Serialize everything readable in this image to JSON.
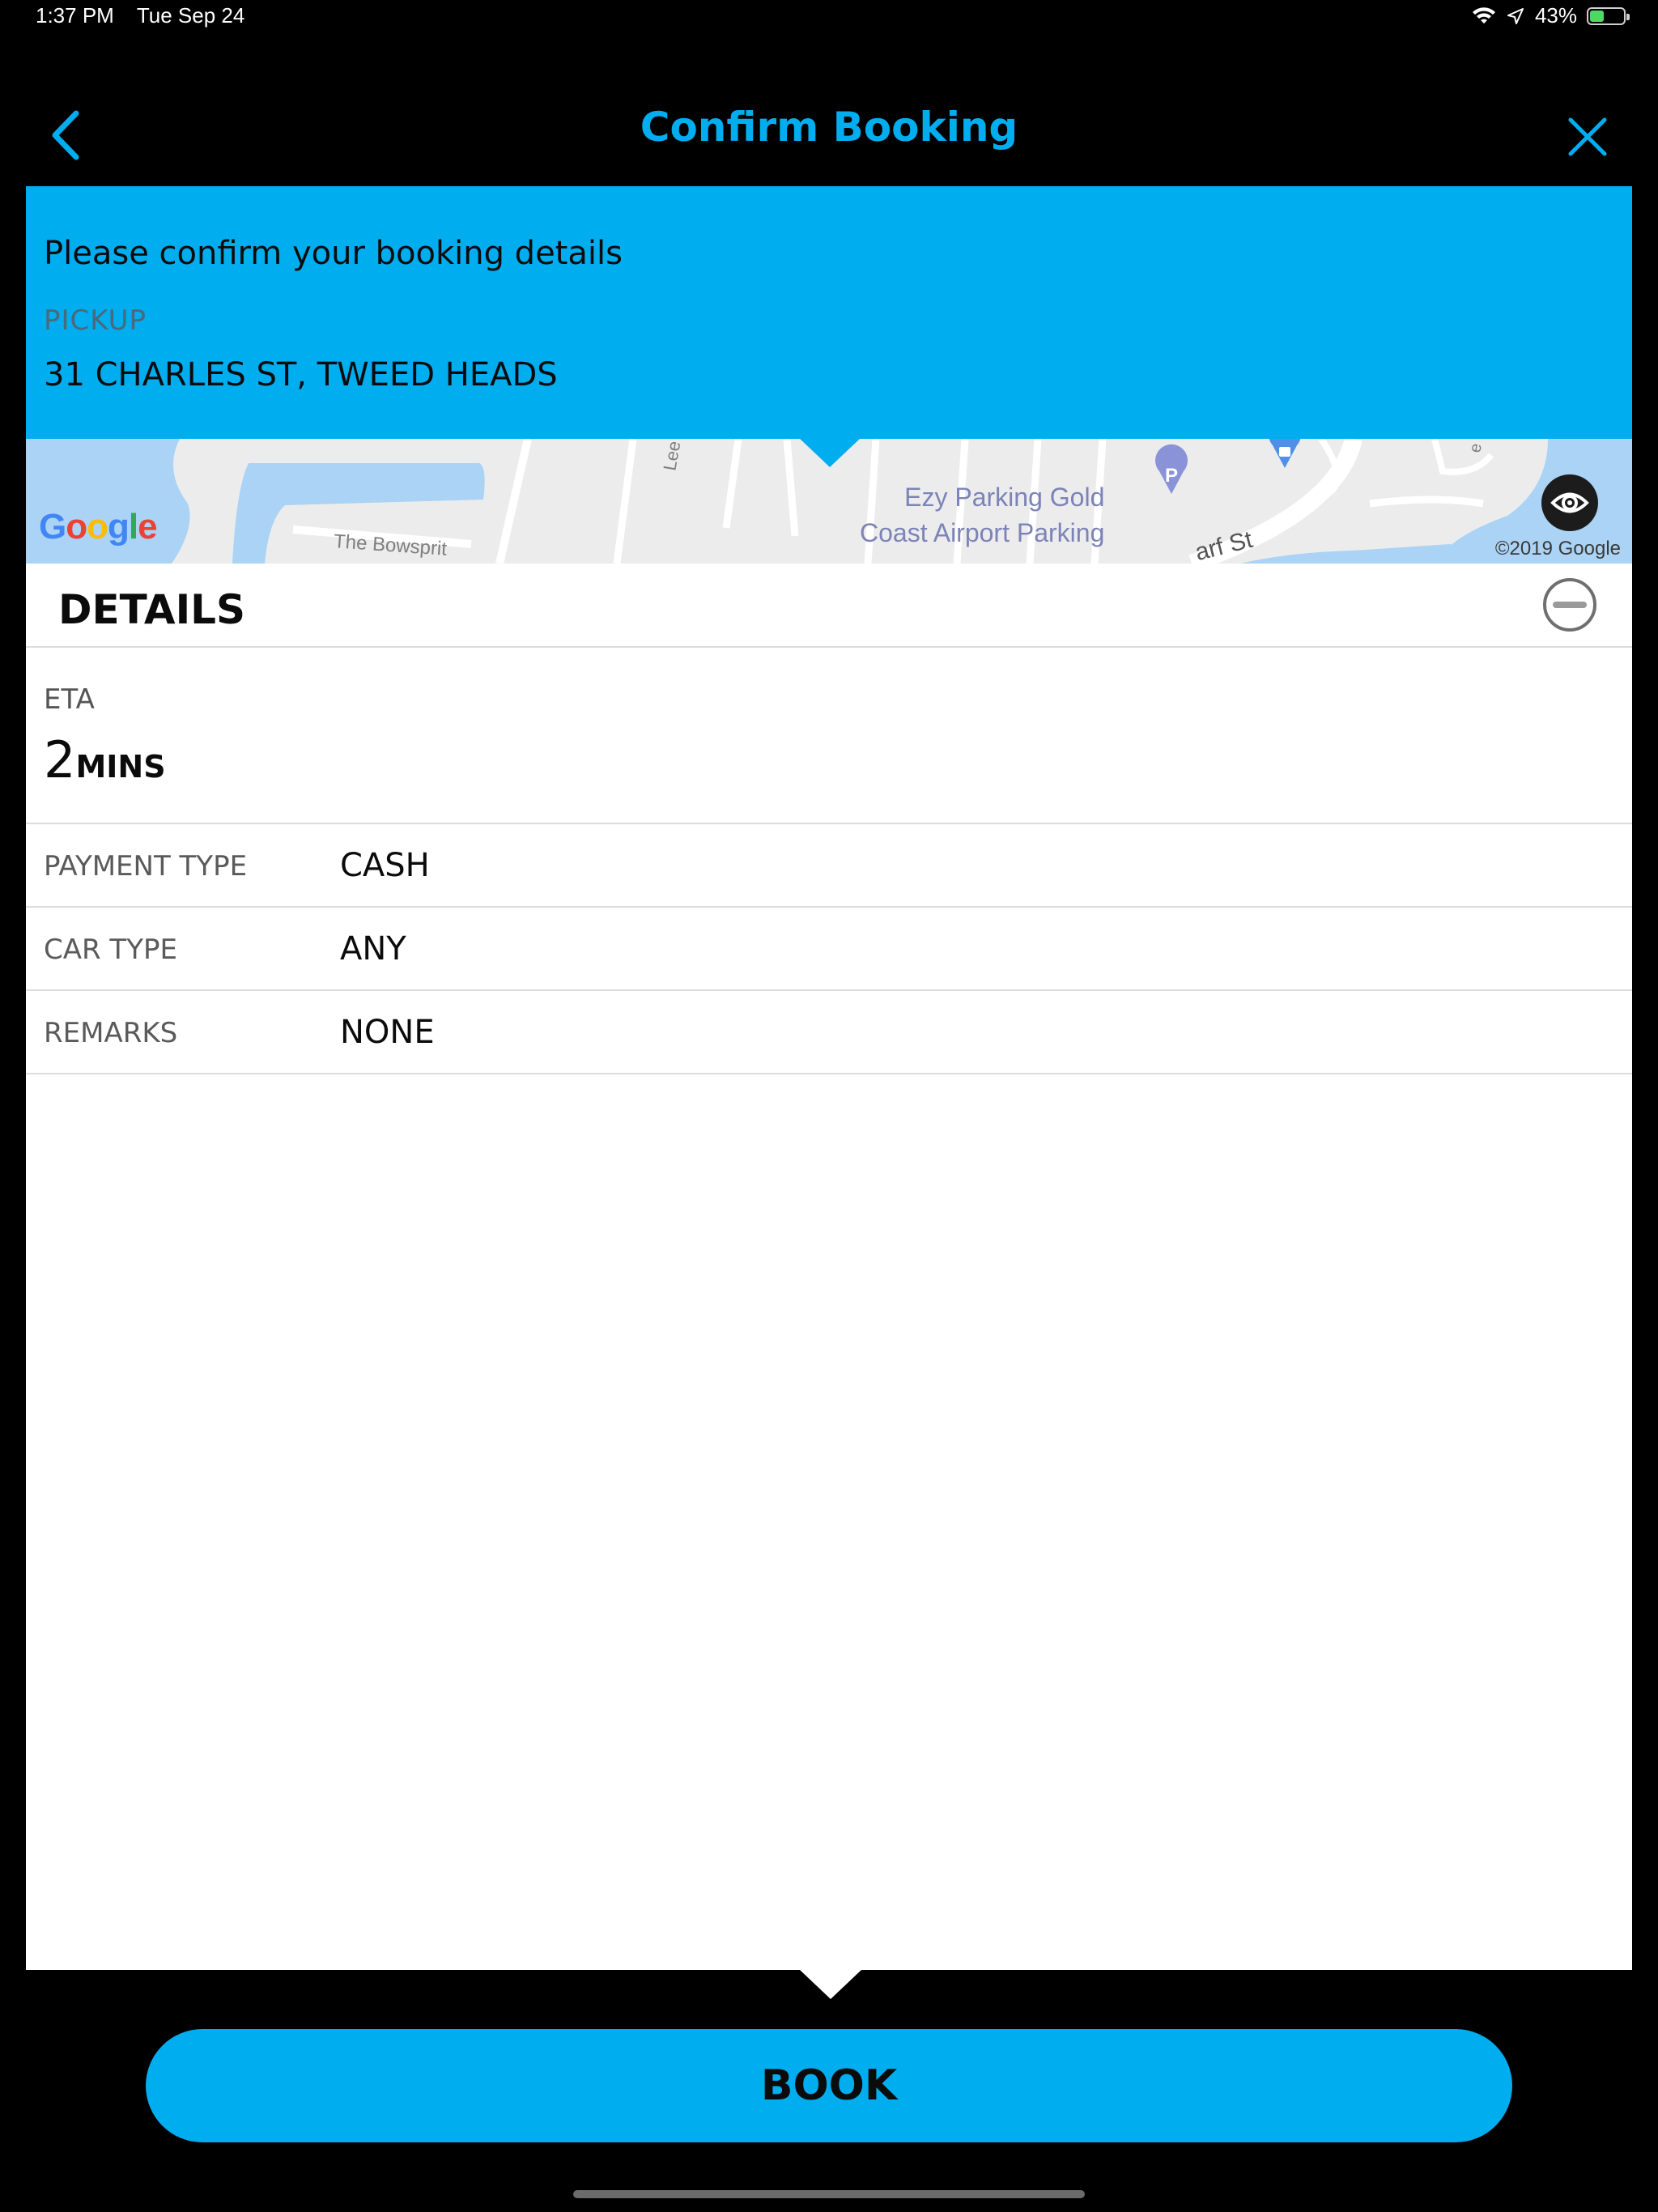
{
  "status_bar": {
    "time": "1:37 PM",
    "date": "Tue Sep 24",
    "battery_percent": "43%",
    "battery_level": 0.43,
    "icons": [
      "wifi-icon",
      "location-arrow-icon",
      "battery-charging-icon"
    ]
  },
  "nav": {
    "title": "Confirm Booking",
    "back_icon": "chevron-left-icon",
    "close_icon": "close-icon"
  },
  "confirm": {
    "prompt": "Please confirm your booking details",
    "pickup_label": "PICKUP",
    "pickup_value": "31 CHARLES ST, TWEED HEADS"
  },
  "map": {
    "labels": {
      "poi_line1": "Ezy Parking Gold",
      "poi_line2": "Coast Airport Parking",
      "street_bowsprit": "The Bowsprit",
      "street_lee": "Lee",
      "street_wharf": "arf St",
      "street_e": "e"
    },
    "logo": "Google",
    "copyright": "©2019 Google",
    "eye_icon": "eye-icon"
  },
  "details": {
    "title": "DETAILS",
    "collapse_icon": "minus-circle-icon",
    "eta_label": "ETA",
    "eta_number": "2",
    "eta_unit": "MINS",
    "rows": [
      {
        "label": "PAYMENT TYPE",
        "value": "CASH"
      },
      {
        "label": "CAR TYPE",
        "value": "ANY"
      },
      {
        "label": "REMARKS",
        "value": "NONE"
      }
    ]
  },
  "actions": {
    "book_label": "BOOK"
  },
  "colors": {
    "accent": "#00adef",
    "background": "#000000",
    "card": "#ffffff"
  }
}
